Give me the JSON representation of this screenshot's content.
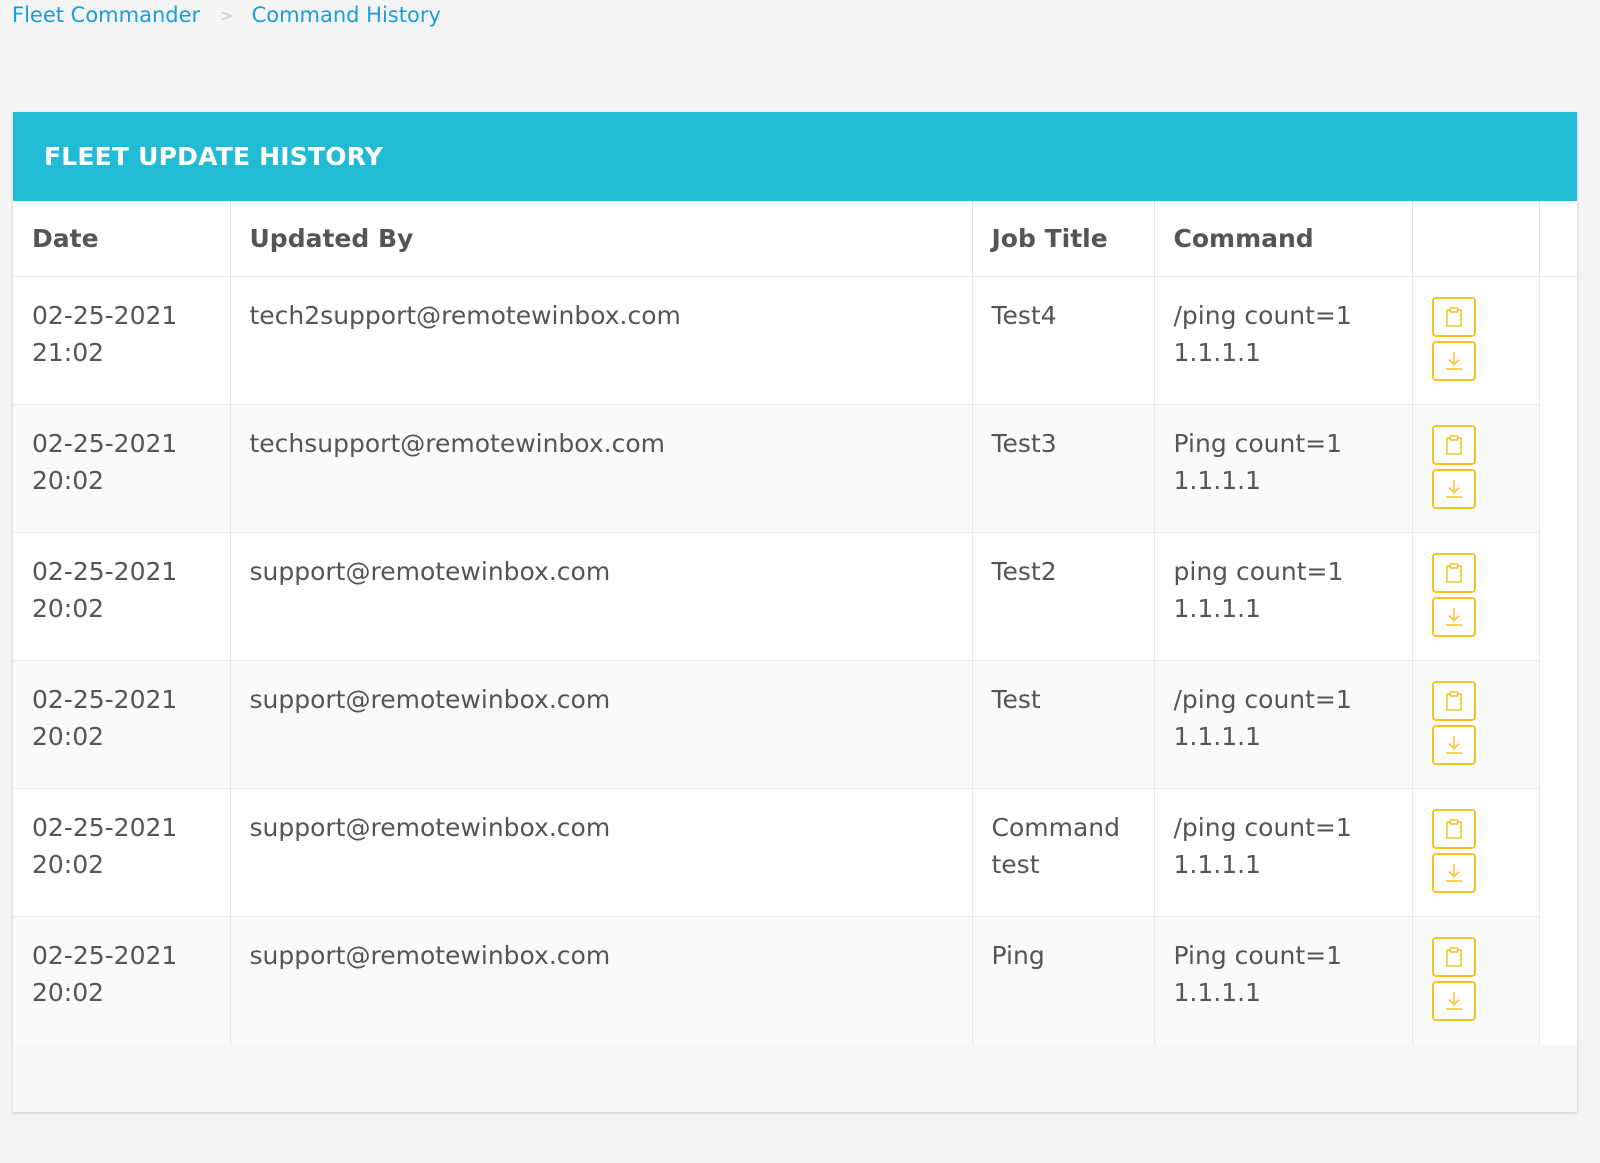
{
  "breadcrumb": {
    "home": "Fleet Commander",
    "separator": ">",
    "current": "Command History"
  },
  "panel": {
    "title": "FLEET UPDATE HISTORY"
  },
  "table": {
    "headers": {
      "date": "Date",
      "updated_by": "Updated By",
      "job_title": "Job Title",
      "command": "Command"
    },
    "rows": [
      {
        "date": "02-25-2021",
        "time": "21:02",
        "updated_by": "tech2support@remotewinbox.com",
        "job_title_1": "Test4",
        "job_title_2": "",
        "command_1": "/ping count=1",
        "command_2": "1.1.1.1"
      },
      {
        "date": "02-25-2021",
        "time": "20:02",
        "updated_by": "techsupport@remotewinbox.com",
        "job_title_1": "Test3",
        "job_title_2": "",
        "command_1": "Ping count=1",
        "command_2": "1.1.1.1"
      },
      {
        "date": "02-25-2021",
        "time": "20:02",
        "updated_by": "support@remotewinbox.com",
        "job_title_1": "Test2",
        "job_title_2": "",
        "command_1": "ping count=1",
        "command_2": "1.1.1.1"
      },
      {
        "date": "02-25-2021",
        "time": "20:02",
        "updated_by": "support@remotewinbox.com",
        "job_title_1": "Test",
        "job_title_2": "",
        "command_1": "/ping count=1",
        "command_2": "1.1.1.1"
      },
      {
        "date": "02-25-2021",
        "time": "20:02",
        "updated_by": "support@remotewinbox.com",
        "job_title_1": "Command",
        "job_title_2": "test",
        "command_1": "/ping count=1",
        "command_2": "1.1.1.1"
      },
      {
        "date": "02-25-2021",
        "time": "20:02",
        "updated_by": "support@remotewinbox.com",
        "job_title_1": "Ping",
        "job_title_2": "",
        "command_1": "Ping count=1",
        "command_2": "1.1.1.1"
      }
    ],
    "actions": {
      "copy_icon": "clipboard-icon",
      "download_icon": "download-icon"
    }
  },
  "colors": {
    "header_bg": "#21bcd4",
    "link": "#1a9dd9",
    "action_border": "#f7c125"
  }
}
